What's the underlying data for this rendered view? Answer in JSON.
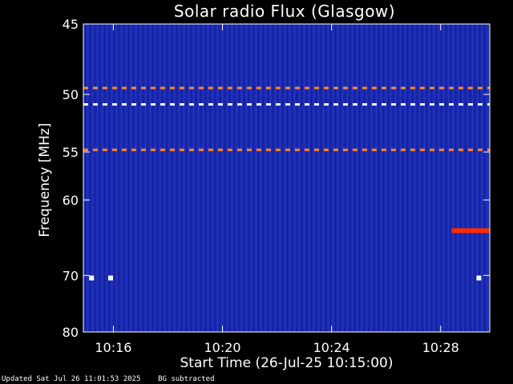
{
  "chart_data": {
    "type": "heatmap",
    "title": "Solar radio Flux (Glasgow)",
    "xlabel": "Start Time (26-Jul-25 10:15:00)",
    "ylabel": "Frequency [MHz]",
    "x_tick_labels": [
      "10:16",
      "10:20",
      "10:24",
      "10:28"
    ],
    "x_ticks_minutes_after_start": [
      1,
      5,
      9,
      13
    ],
    "x_range_minutes_after_start": [
      -0.1,
      14.8
    ],
    "y_tick_labels": [
      "45",
      "50",
      "55",
      "60",
      "70",
      "80"
    ],
    "y_ticks": [
      45,
      50,
      55,
      60,
      70,
      80
    ],
    "y_range": [
      45,
      80
    ],
    "y_scale": "reciprocal",
    "y_inverted": false,
    "background_color": "#1a2ab0",
    "frame_color": "#ffffff",
    "features": [
      {
        "type": "dashed-band",
        "freq_mhz": 49.5,
        "color": "#ff8a2a"
      },
      {
        "type": "dashed-band",
        "freq_mhz": 50.8,
        "color": "#ffffff"
      },
      {
        "type": "dashed-band",
        "freq_mhz": 54.8,
        "color": "#ffffff"
      },
      {
        "type": "dashed-band",
        "freq_mhz": 54.8,
        "color": "#ff7a20"
      },
      {
        "type": "emission",
        "freq_mhz": 63.7,
        "minutes_after_start": [
          13.4,
          14.8
        ],
        "color": "#ff2a00"
      },
      {
        "type": "spot",
        "freq_mhz": 70.4,
        "minutes_after_start": 0.2,
        "color": "#ffffff"
      },
      {
        "type": "spot",
        "freq_mhz": 70.4,
        "minutes_after_start": 0.9,
        "color": "#ffffff"
      },
      {
        "type": "spot",
        "freq_mhz": 70.4,
        "minutes_after_start": 14.4,
        "color": "#ffffff"
      }
    ]
  },
  "footer": {
    "updated": "Updated Sat Jul 26 11:01:53 2025",
    "note": "BG subtracted"
  }
}
